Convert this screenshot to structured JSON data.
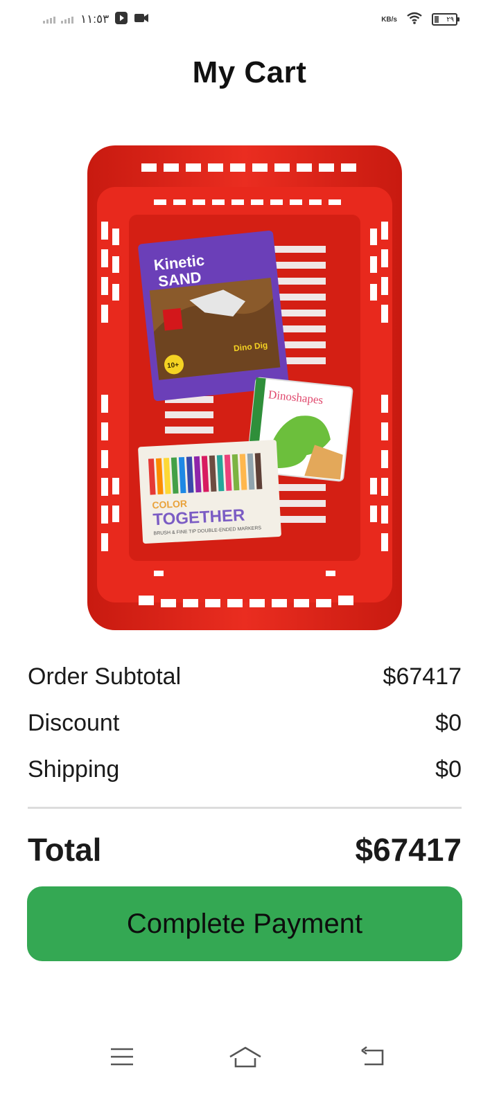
{
  "status_bar": {
    "time": "١١:٥٣",
    "net_speed": "KB/s",
    "battery_level": "٢٩",
    "icons": [
      "signal-icon",
      "signal-icon",
      "play-icon",
      "video-camera-icon",
      "wifi-icon",
      "battery-icon"
    ]
  },
  "page": {
    "title": "My Cart"
  },
  "cart": {
    "products": [
      {
        "title_line1": "Kinetic",
        "title_line2": "SAND",
        "badge": "10+",
        "caption": "Dino Dig"
      },
      {
        "title": "Dinoshapes"
      },
      {
        "title_line1": "COLOR",
        "title_line2": "TOGETHER",
        "caption": "BRUSH & FINE TIP DOUBLE-ENDED MARKERS"
      }
    ]
  },
  "summary": {
    "subtotal_label": "Order Subtotal",
    "subtotal_value": "$67417",
    "discount_label": "Discount",
    "discount_value": "$0",
    "shipping_label": "Shipping",
    "shipping_value": "$0",
    "total_label": "Total",
    "total_value": "$67417"
  },
  "actions": {
    "pay_label": "Complete Payment"
  },
  "colors": {
    "accent": "#34a853",
    "basket": "#e3261b"
  },
  "nav": {
    "icons": [
      "menu-icon",
      "home-icon",
      "back-icon"
    ]
  }
}
